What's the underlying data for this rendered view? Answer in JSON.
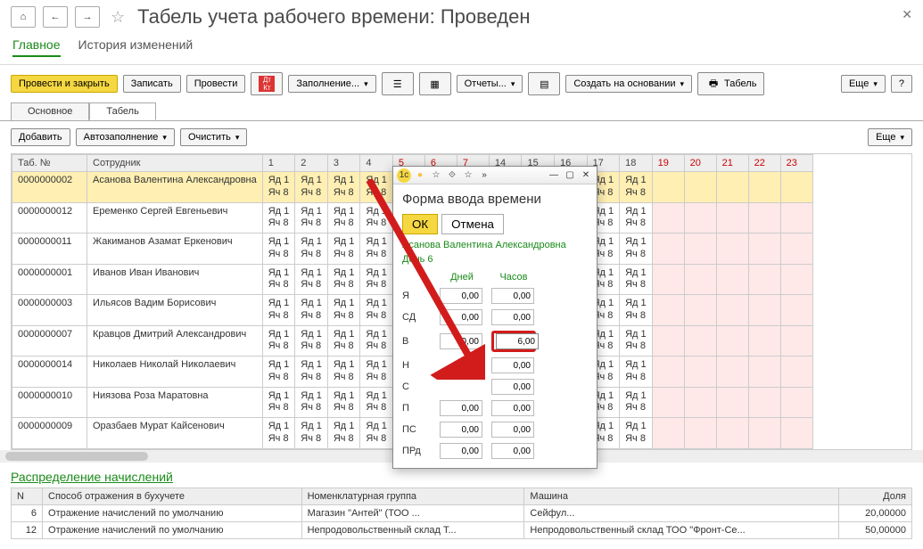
{
  "header": {
    "title": "Табель учета рабочего времени: Проведен"
  },
  "topTabs": {
    "t0": "Главное",
    "t1": "История изменений"
  },
  "toolbar": {
    "postClose": "Провести и закрыть",
    "write": "Записать",
    "post": "Провести",
    "fill": "Заполнение...",
    "reports": "Отчеты...",
    "createBased": "Создать на основании",
    "timesheet": "Табель",
    "more": "Еще",
    "help": "?"
  },
  "subTabs": {
    "t0": "Основное",
    "t1": "Табель"
  },
  "subToolbar": {
    "add": "Добавить",
    "autofill": "Автозаполнение",
    "clear": "Очистить",
    "more": "Еще"
  },
  "table": {
    "colTabNum": "Таб. №",
    "colEmp": "Сотрудник",
    "days": [
      "1",
      "2",
      "3",
      "4",
      "5",
      "6",
      "7",
      "14",
      "15",
      "16",
      "17",
      "18",
      "19",
      "20",
      "21",
      "22",
      "23"
    ],
    "visibleDays": [
      "1",
      "2",
      "3",
      "4",
      "14",
      "15",
      "16",
      "17",
      "18"
    ],
    "redDays": [
      "5",
      "6",
      "7",
      "19",
      "20",
      "21",
      "22",
      "23"
    ],
    "rows": [
      {
        "num": "0000000002",
        "emp": "Асанова Валентина Александровна",
        "sel": true
      },
      {
        "num": "0000000012",
        "emp": "Еременко Сергей Евгеньевич"
      },
      {
        "num": "0000000011",
        "emp": "Жакиманов Азамат Еркенович"
      },
      {
        "num": "0000000001",
        "emp": "Иванов Иван Иванович"
      },
      {
        "num": "0000000003",
        "emp": "Ильясов Вадим Борисович"
      },
      {
        "num": "0000000007",
        "emp": "Кравцов Дмитрий Александрович"
      },
      {
        "num": "0000000014",
        "emp": "Николаев Николай Николаевич"
      },
      {
        "num": "0000000010",
        "emp": "Ниязова Роза Маратовна"
      },
      {
        "num": "0000000009",
        "emp": "Оразбаев Мурат Кайсенович"
      }
    ],
    "cellTop": "Яд 1",
    "cellBot": "Яч 8"
  },
  "dist": {
    "title": "Распределение начислений",
    "cols": {
      "n": "N",
      "method": "Способ отражения в бухучете",
      "nomen": "Номенклатурная группа",
      "machine": "Машина",
      "share": "Доля"
    },
    "rows": [
      {
        "n": "6",
        "method": "Отражение начислений по умолчанию",
        "nomen": "Магазин \"Антей\" (ТОО ...",
        "machine": "Сейфул...",
        "share": "20,00000"
      },
      {
        "n": "12",
        "method": "Отражение начислений по умолчанию",
        "nomen": "Непродовольственный склад Т...",
        "machine": "Непродовольственный склад ТОО \"Фронт-Се...",
        "share": "50,00000"
      }
    ]
  },
  "modal": {
    "title": "Форма ввода времени",
    "ok": "ОК",
    "cancel": "Отмена",
    "emp": "Асанова Валентина Александровна",
    "day": "День 6",
    "colDays": "Дней",
    "colHours": "Часов",
    "rows": [
      {
        "k": "Я",
        "d": "0,00",
        "h": "0,00"
      },
      {
        "k": "СД",
        "d": "0,00",
        "h": "0,00"
      },
      {
        "k": "В",
        "d": "0,00",
        "h": "6,00",
        "hl": true
      },
      {
        "k": "Н",
        "d": "",
        "h": "0,00"
      },
      {
        "k": "С",
        "d": "",
        "h": "0,00"
      },
      {
        "k": "П",
        "d": "0,00",
        "h": "0,00"
      },
      {
        "k": "ПС",
        "d": "0,00",
        "h": "0,00"
      },
      {
        "k": "ПРд",
        "d": "0,00",
        "h": "0,00"
      }
    ]
  }
}
